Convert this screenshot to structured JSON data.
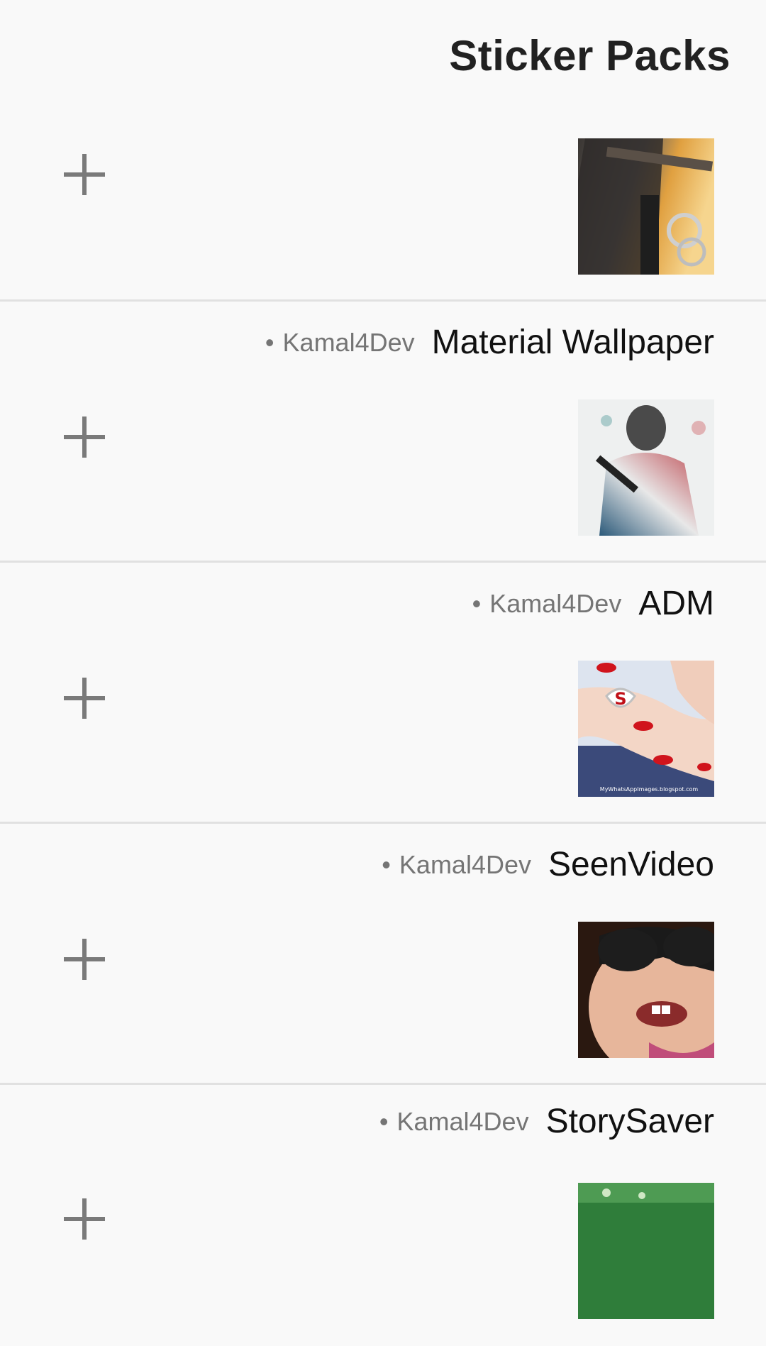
{
  "header": {
    "title": "Sticker Packs"
  },
  "packs": [
    {
      "name": "",
      "author": "",
      "add_icon": "plus-icon",
      "thumbnail": "police-belt-handcuffs-image"
    },
    {
      "name": "Material Wallpaper",
      "author": "Kamal4Dev",
      "bullet": "•",
      "add_icon": "plus-icon",
      "thumbnail": "soldier-art-image"
    },
    {
      "name": "ADM",
      "author": "Kamal4Dev",
      "bullet": "•",
      "add_icon": "plus-icon",
      "thumbnail": "ring-hand-image",
      "thumbnail_caption": "MyWhatsAppImages.blogspot.com"
    },
    {
      "name": "SeenVideo",
      "author": "Kamal4Dev",
      "bullet": "•",
      "add_icon": "plus-icon",
      "thumbnail": "child-sunglasses-image"
    },
    {
      "name": "StorySaver",
      "author": "Kamal4Dev",
      "bullet": "•",
      "add_icon": "plus-icon",
      "thumbnail": "green-image"
    }
  ],
  "colors": {
    "background": "#f9f9f9",
    "divider": "#e1e1e1",
    "plus": "#7a7a7a",
    "title": "#212121",
    "author": "#757575"
  }
}
